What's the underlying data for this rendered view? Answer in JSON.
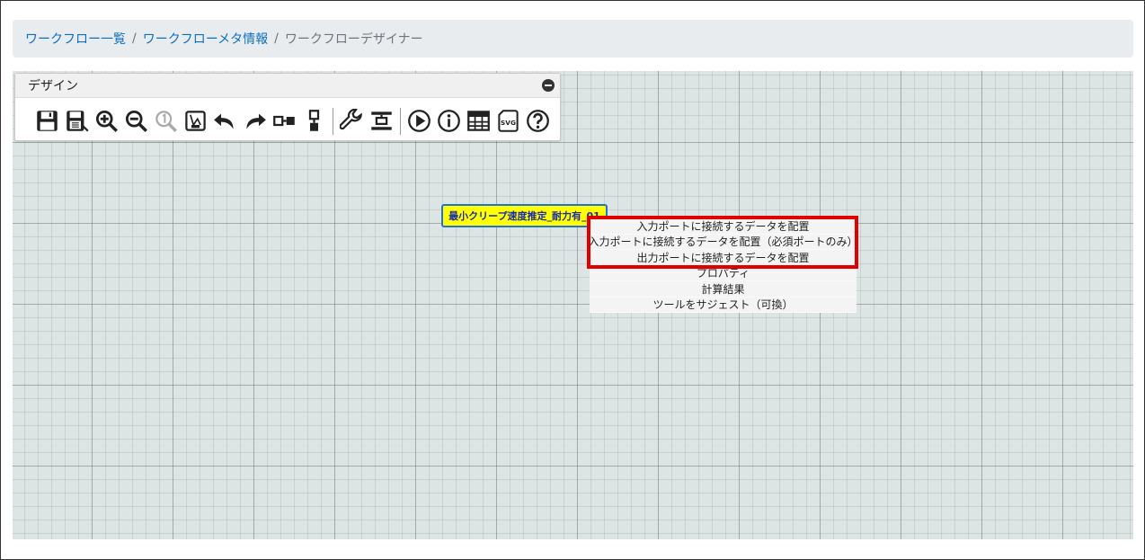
{
  "breadcrumb": {
    "items": [
      "ワークフロー一覧",
      "ワークフローメタ情報"
    ],
    "current": "ワークフローデザイナー",
    "separator": "/"
  },
  "design_panel": {
    "title": "デザイン",
    "tools": [
      {
        "name": "save-icon"
      },
      {
        "name": "save-as-icon"
      },
      {
        "name": "zoom-in-icon"
      },
      {
        "name": "zoom-out-icon"
      },
      {
        "name": "zoom-reset-icon"
      },
      {
        "name": "fit-icon"
      },
      {
        "name": "undo-icon"
      },
      {
        "name": "redo-icon"
      },
      {
        "name": "horizontal-layout-icon"
      },
      {
        "name": "vertical-layout-icon"
      },
      {
        "name": "wrench-icon"
      },
      {
        "name": "align-icon"
      },
      {
        "name": "run-icon"
      },
      {
        "name": "info-icon"
      },
      {
        "name": "table-icon"
      },
      {
        "name": "svg-export-icon"
      },
      {
        "name": "help-icon"
      }
    ],
    "svg_label": "SVG"
  },
  "node": {
    "label": "最小クリープ速度推定_耐力有_01",
    "fill": "#ffff00",
    "border": "#1e74d6"
  },
  "context_menu": {
    "items": [
      "入力ポートに接続するデータを配置",
      "入力ポートに接続するデータを配置（必須ポートのみ）",
      "出力ポートに接続するデータを配置",
      "プロパティ",
      "計算結果",
      "ツールをサジェスト（可換）"
    ],
    "highlight_color": "#e00000"
  }
}
